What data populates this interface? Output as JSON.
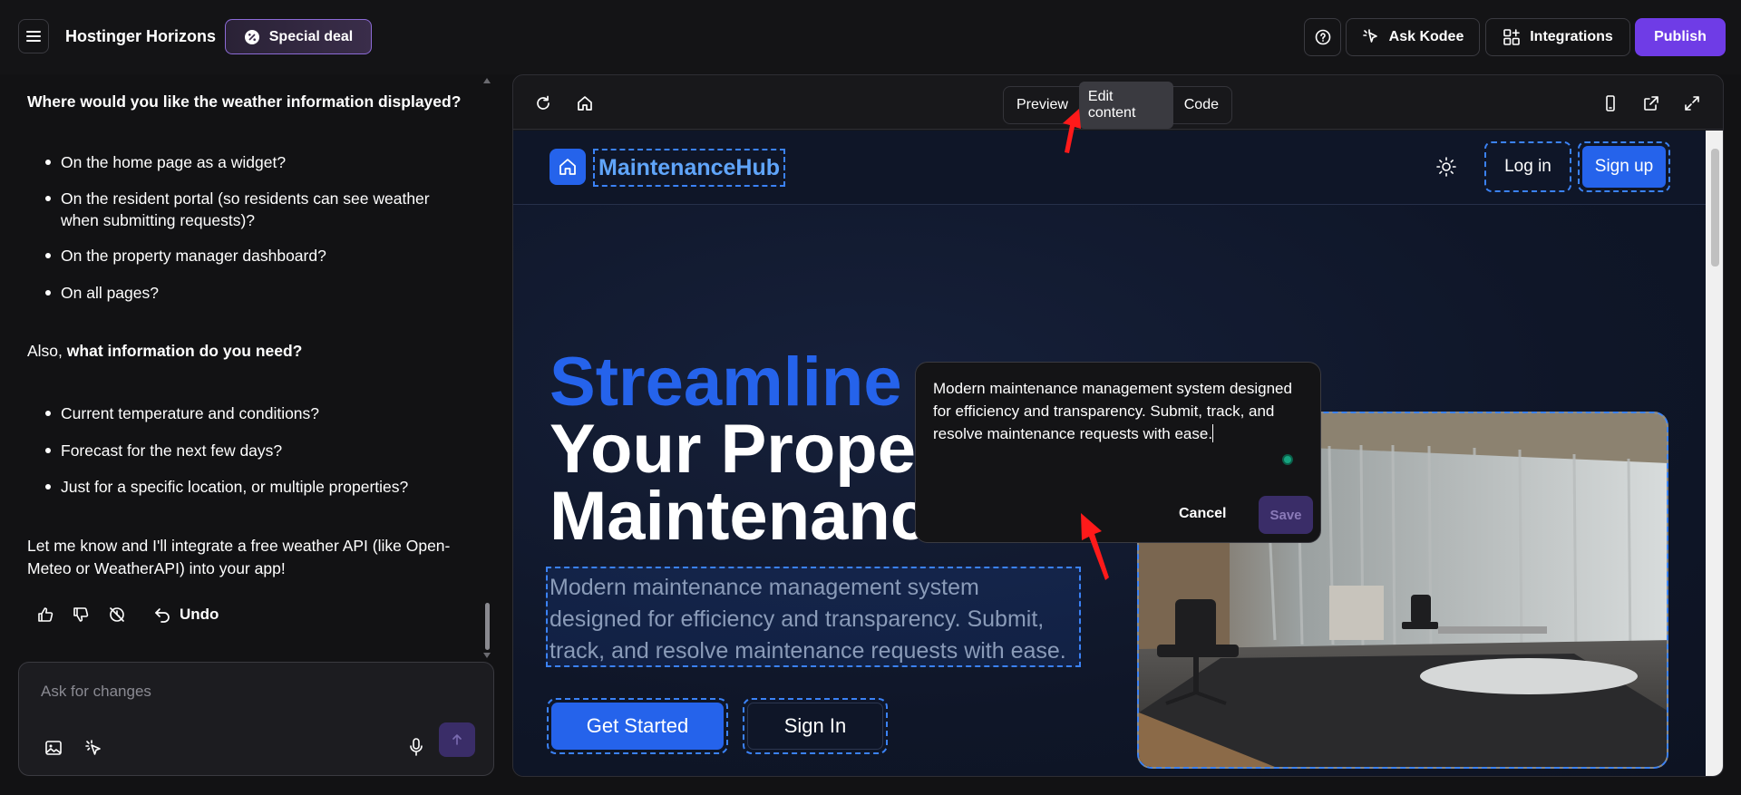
{
  "topbar": {
    "brand": "Hostinger Horizons",
    "special_deal": "Special deal",
    "ask_kodee": "Ask Kodee",
    "integrations": "Integrations",
    "publish": "Publish"
  },
  "chat": {
    "q1_prefix": "Where would you like the weather information displayed?",
    "locations": [
      "On the home page as a widget?",
      "On the resident portal (so residents can see weather when submitting requests)?",
      "On the property manager dashboard?",
      "On all pages?"
    ],
    "q2_prefix": "Also, ",
    "q2_bold": "what information do you need?",
    "info_items": [
      "Current temperature and conditions?",
      "Forecast for the next few days?",
      "Just for a specific location, or multiple properties?"
    ],
    "closing": "Let me know and I'll integrate a free weather API (like Open-Meteo or WeatherAPI) into your app!",
    "undo": "Undo",
    "input_placeholder": "Ask for changes"
  },
  "preview": {
    "tabs": [
      "Preview",
      "Edit content",
      "Code"
    ],
    "active_tab": "Edit content"
  },
  "site": {
    "brand": "MaintenanceHub",
    "login": "Log in",
    "signup": "Sign up",
    "headline_accent": "Streamline",
    "headline_line2": "Your Proper",
    "headline_line3": "Maintenance",
    "description": "Modern maintenance management system designed for efficiency and transparency. Submit, track, and resolve maintenance requests with ease.",
    "get_started": "Get Started",
    "sign_in": "Sign In"
  },
  "editor": {
    "text": "Modern maintenance management system designed for efficiency and transparency. Submit, track, and resolve maintenance requests with ease.",
    "cancel": "Cancel",
    "save": "Save"
  },
  "colors": {
    "accent_purple": "#6f3ce6",
    "site_blue": "#2563eb",
    "annotation_red": "#ff1a1a"
  }
}
